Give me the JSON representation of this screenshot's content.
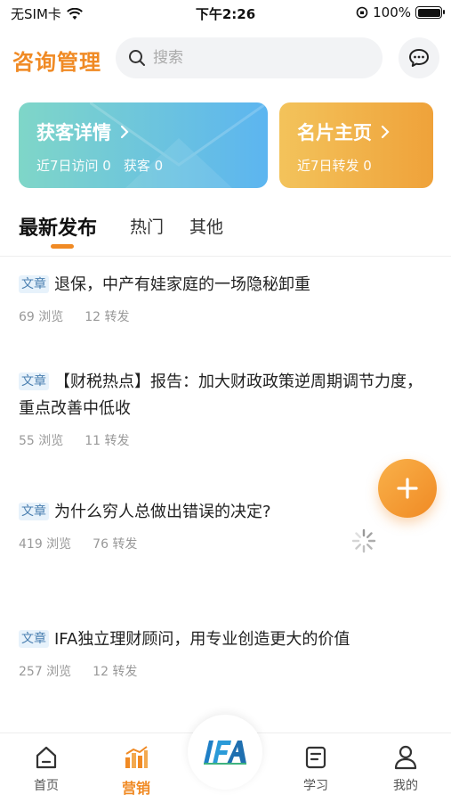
{
  "status_bar": {
    "carrier": "无SIM卡",
    "time": "下午2:26",
    "battery": "100%",
    "battery_level": 1.0
  },
  "header": {
    "title": "咨询管理",
    "search_placeholder": "搜索",
    "message_icon": "chat-bubble-icon"
  },
  "cards": [
    {
      "title": "获客详情",
      "stats": [
        "近7日访问 0",
        "获客 0"
      ],
      "color_start": "#7fd6c8",
      "color_end": "#5cb5f0"
    },
    {
      "title": "名片主页",
      "stats": [
        "近7日转发 0"
      ],
      "color_start": "#f3c35b",
      "color_end": "#efa23a"
    }
  ],
  "tabs": [
    {
      "label": "最新发布",
      "active": true
    },
    {
      "label": "热门",
      "active": false
    },
    {
      "label": "其他",
      "active": false
    }
  ],
  "feed": [
    {
      "tag": "文章",
      "title": "退保，中产有娃家庭的一场隐秘卸重",
      "views": "69 浏览",
      "shares": "12 转发"
    },
    {
      "tag": "文章",
      "title": "【财税热点】报告：加大财政政策逆周期调节力度，重点改善中低收",
      "views": "55 浏览",
      "shares": "11 转发"
    },
    {
      "tag": "文章",
      "title": "为什么穷人总做出错误的决定?",
      "views": "419 浏览",
      "shares": "76 转发"
    },
    {
      "tag": "文章",
      "title": "IFA独立理财顾问，用专业创造更大的价值",
      "views": "257 浏览",
      "shares": "12 转发"
    }
  ],
  "fab": {
    "icon": "plus-icon"
  },
  "bottom_nav": [
    {
      "label": "首页",
      "icon": "home-icon",
      "active": false
    },
    {
      "label": "营销",
      "icon": "bar-chart-icon",
      "active": true
    },
    {
      "label": "学习",
      "icon": "document-icon",
      "active": false
    },
    {
      "label": "我的",
      "icon": "user-icon",
      "active": false
    }
  ],
  "center_logo": {
    "icon": "ifa-logo"
  },
  "colors": {
    "accent": "#f08a24",
    "tag_bg": "#e7f2fb",
    "tag_text": "#4a7fb0",
    "meta": "#999999"
  }
}
